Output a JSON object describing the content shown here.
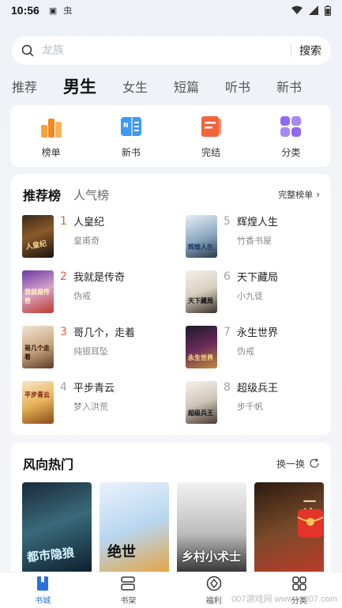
{
  "status_bar": {
    "time": "10:56"
  },
  "search": {
    "placeholder": "龙族",
    "button_label": "搜索"
  },
  "tabs": [
    {
      "label": "推荐"
    },
    {
      "label": "男生"
    },
    {
      "label": "女生"
    },
    {
      "label": "短篇"
    },
    {
      "label": "听书"
    },
    {
      "label": "新书"
    }
  ],
  "quick_links": [
    {
      "label": "榜单"
    },
    {
      "label": "新书"
    },
    {
      "label": "完结"
    },
    {
      "label": "分类"
    }
  ],
  "ranking": {
    "tab_active": "推荐榜",
    "tab_inactive": "人气榜",
    "more_label": "完整榜单",
    "items": [
      {
        "rank": "1",
        "title": "人皇纪",
        "author": "皇甫奇"
      },
      {
        "rank": "2",
        "title": "我就是传奇",
        "author": "伪戒"
      },
      {
        "rank": "3",
        "title": "哥几个，走着",
        "author": "纯银耳坠"
      },
      {
        "rank": "4",
        "title": "平步青云",
        "author": "梦入洪荒"
      },
      {
        "rank": "5",
        "title": "辉煌人生",
        "author": "竹香书屋"
      },
      {
        "rank": "6",
        "title": "天下藏局",
        "author": "小九徒"
      },
      {
        "rank": "7",
        "title": "永生世界",
        "author": "伪戒"
      },
      {
        "rank": "8",
        "title": "超级兵王",
        "author": "步千帆"
      }
    ]
  },
  "hot": {
    "title": "风向热门",
    "refresh_label": "换一换"
  },
  "bottom_nav": [
    {
      "label": "书城"
    },
    {
      "label": "书架"
    },
    {
      "label": "福利"
    },
    {
      "label": "分类"
    }
  ],
  "watermark": "007游戏网 www.yx007.com",
  "colors": {
    "accent": "#2a6fdb",
    "rank_top": "#e25b3d"
  }
}
